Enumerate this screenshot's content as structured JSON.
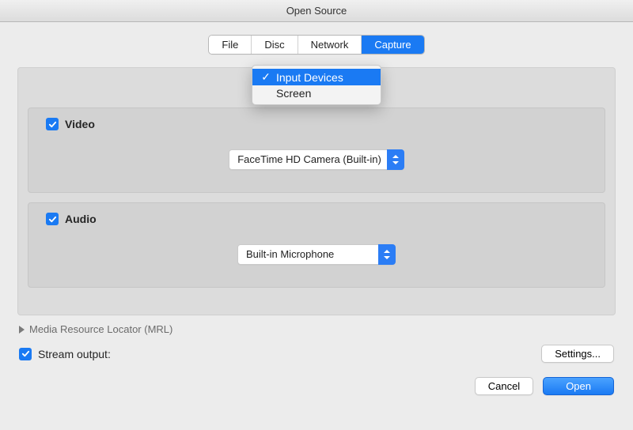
{
  "window": {
    "title": "Open Source"
  },
  "tabs": {
    "file": "File",
    "disc": "Disc",
    "network": "Network",
    "capture": "Capture"
  },
  "capture_menu": {
    "input_devices": "Input Devices",
    "screen": "Screen"
  },
  "video": {
    "label": "Video",
    "selected": "FaceTime HD Camera (Built-in)"
  },
  "audio": {
    "label": "Audio",
    "selected": "Built-in Microphone"
  },
  "mrl": {
    "label": "Media Resource Locator (MRL)"
  },
  "stream": {
    "label": "Stream output:"
  },
  "buttons": {
    "settings": "Settings...",
    "cancel": "Cancel",
    "open": "Open"
  }
}
